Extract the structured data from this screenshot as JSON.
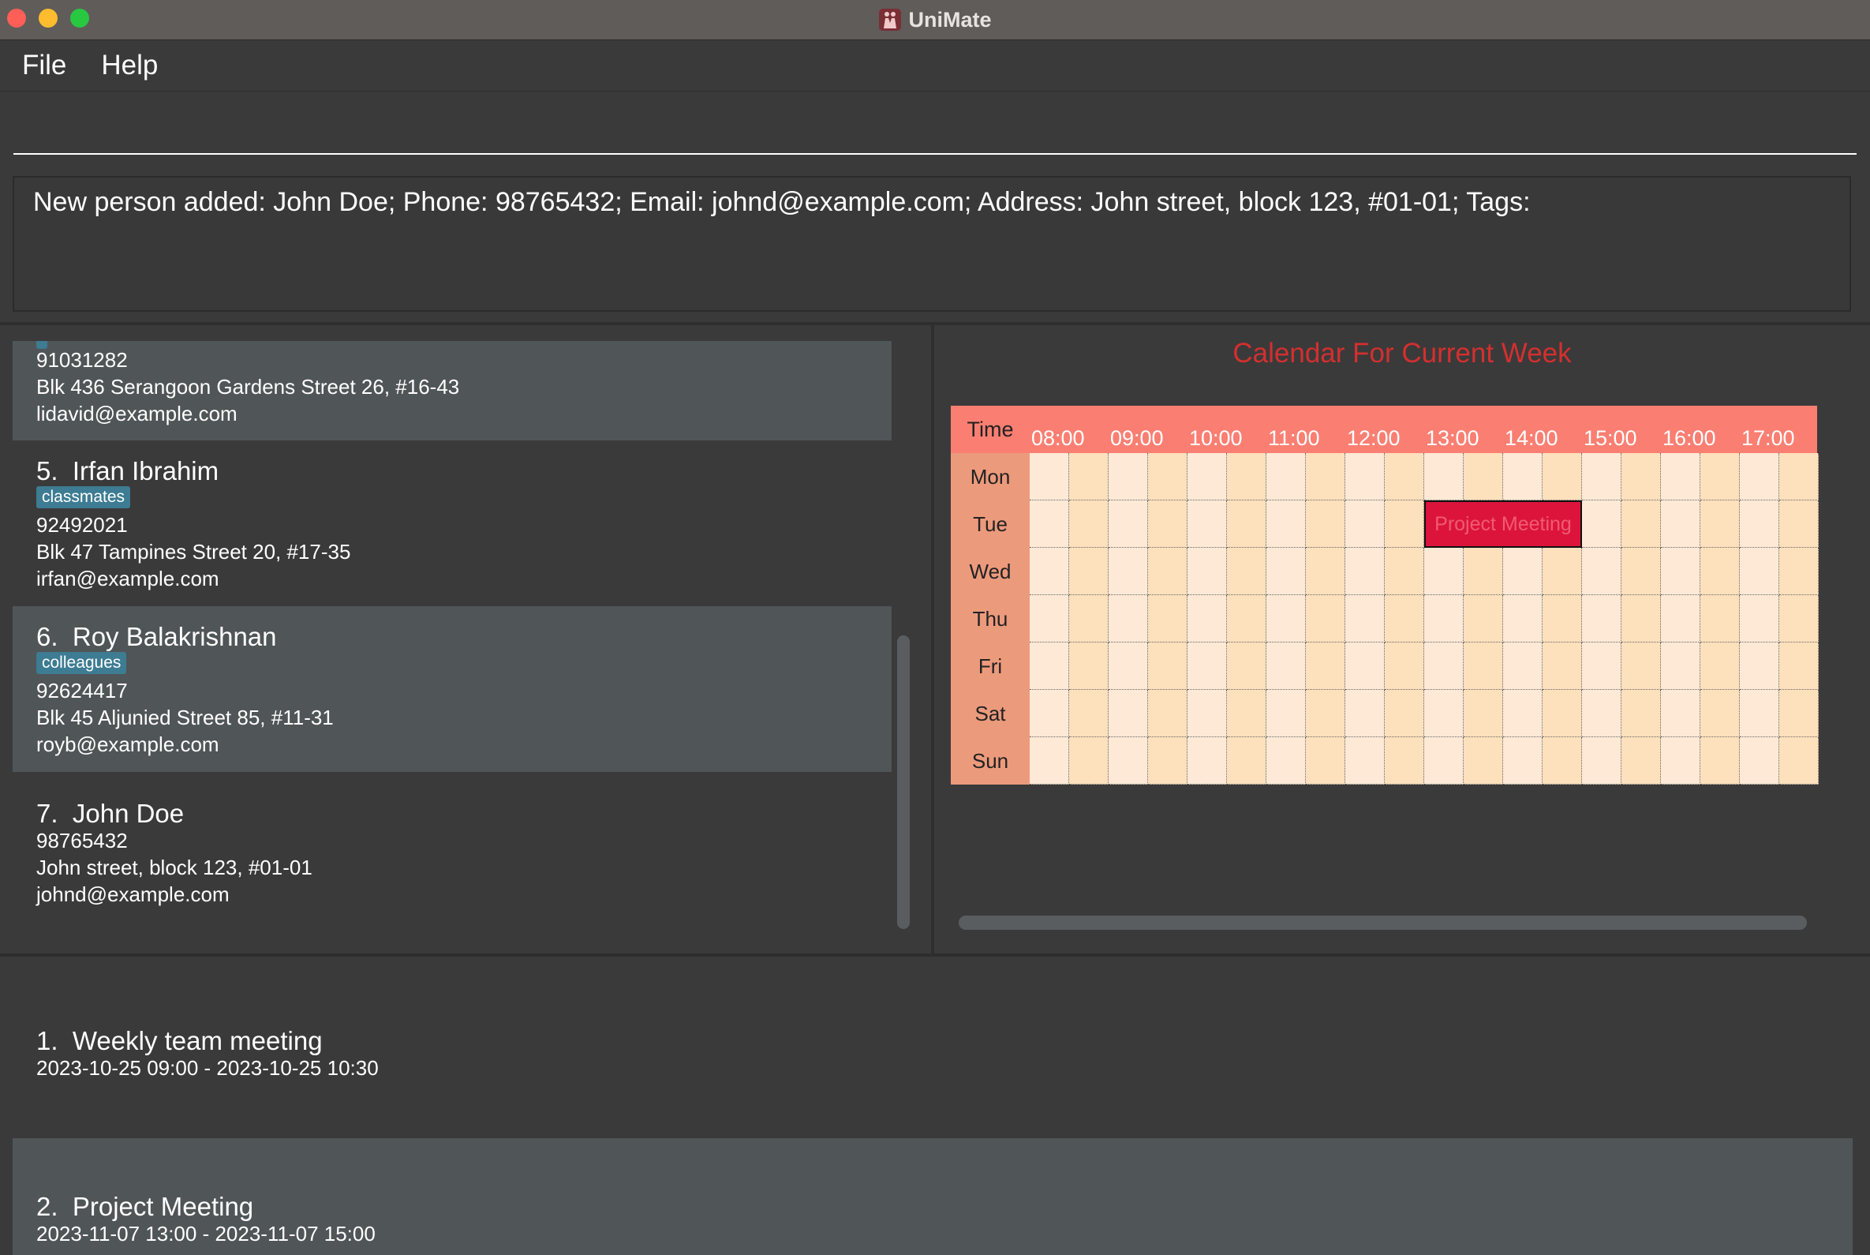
{
  "window": {
    "title": "UniMate"
  },
  "menu": {
    "file": "File",
    "help": "Help"
  },
  "command": {
    "value": ""
  },
  "result": {
    "text": "New person added: John Doe; Phone: 98765432; Email: johnd@example.com; Address: John street, block 123, #01-01; Tags:"
  },
  "persons": [
    {
      "index": "",
      "name": "",
      "tag": "",
      "phone": "91031282",
      "address": "Blk 436 Serangoon Gardens Street 26, #16-43",
      "email": "lidavid@example.com"
    },
    {
      "index": "5.",
      "name": "Irfan Ibrahim",
      "tag": "classmates",
      "phone": "92492021",
      "address": "Blk 47 Tampines Street 20, #17-35",
      "email": "irfan@example.com"
    },
    {
      "index": "6.",
      "name": "Roy Balakrishnan",
      "tag": "colleagues",
      "phone": "92624417",
      "address": "Blk 45 Aljunied Street 85, #11-31",
      "email": "royb@example.com"
    },
    {
      "index": "7.",
      "name": "John Doe",
      "tag": "",
      "phone": "98765432",
      "address": "John street, block 123, #01-01",
      "email": "johnd@example.com"
    }
  ],
  "calendar": {
    "title": "Calendar For Current Week",
    "time_header": "Time",
    "hours": [
      "08:00",
      "09:00",
      "10:00",
      "11:00",
      "12:00",
      "13:00",
      "14:00",
      "15:00",
      "16:00",
      "17:00"
    ],
    "days": [
      "Mon",
      "Tue",
      "Wed",
      "Thu",
      "Fri",
      "Sat",
      "Sun"
    ],
    "events": [
      {
        "label": "Project Meeting",
        "day": "Tue",
        "start": "13:00",
        "end": "15:00",
        "color": "#dc143c"
      }
    ]
  },
  "events": [
    {
      "index": "1.",
      "name": "Weekly team meeting",
      "time": "2023-10-25 09:00 - 2023-10-25 10:30"
    },
    {
      "index": "2.",
      "name": "Project Meeting",
      "time": "2023-11-07 13:00 - 2023-11-07 15:00"
    }
  ]
}
